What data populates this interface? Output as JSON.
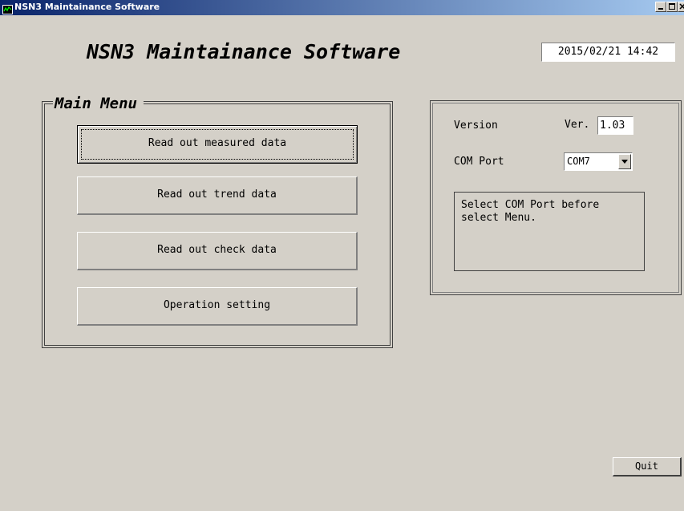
{
  "window": {
    "title": "NSN3 Maintainance Software",
    "controls": [
      "minimize-icon",
      "maximize-icon",
      "close-icon"
    ]
  },
  "header": {
    "app_title": "NSN3 Maintainance Software",
    "datetime": "2015/02/21 14:42"
  },
  "main_menu": {
    "label": "Main Menu",
    "buttons": [
      {
        "label": "Read out measured data",
        "focused": true
      },
      {
        "label": "Read out trend data",
        "focused": false
      },
      {
        "label": "Read out check data",
        "focused": false
      },
      {
        "label": "Operation setting",
        "focused": false
      }
    ]
  },
  "info": {
    "version_label": "Version",
    "version_prefix": "Ver.",
    "version_value": "1.03",
    "com_label": "COM Port",
    "com_selected": "COM7",
    "message": "Select COM Port before select Menu."
  },
  "footer": {
    "quit_label": "Quit"
  },
  "colors": {
    "background": "#d4d0c8",
    "titlebar_start": "#0a246a",
    "titlebar_end": "#a6caf0"
  }
}
